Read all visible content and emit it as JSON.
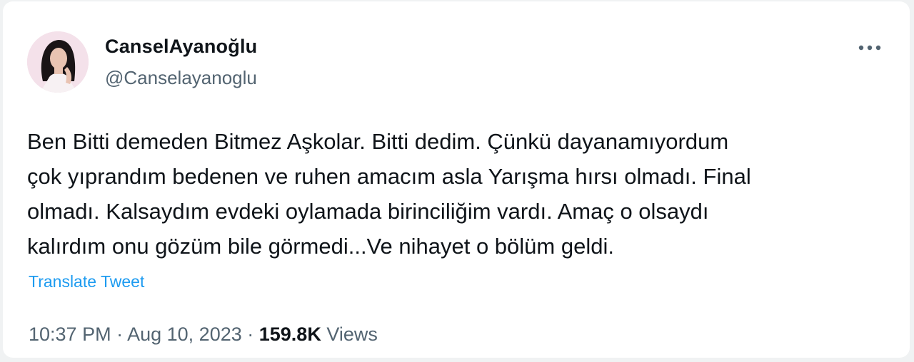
{
  "user": {
    "display_name": "CanselAyanoğlu",
    "handle": "@Canselayanoglu"
  },
  "tweet": {
    "lines": [
      "Ben Bitti demeden Bitmez Aşkolar. Bitti dedim. Çünkü dayanamıyordum",
      "çok yıprandım bedenen ve ruhen amacım asla Yarışma hırsı olmadı. Final",
      "olmadı. Kalsaydım evdeki oylamada birinciliğim vardı. Amaç o olsaydı",
      "kalırdım onu gözüm bile görmedi...Ve nihayet o bölüm geldi."
    ],
    "translate_label": "Translate Tweet"
  },
  "meta": {
    "time": "10:37 PM",
    "separator": " · ",
    "date": "Aug 10, 2023",
    "views_count": "159.8K",
    "views_label": "Views"
  },
  "icons": {
    "more": "more-horizontal-icon"
  },
  "colors": {
    "link": "#1d9bf0",
    "secondary_text": "#536471",
    "primary_text": "#0f1419"
  }
}
